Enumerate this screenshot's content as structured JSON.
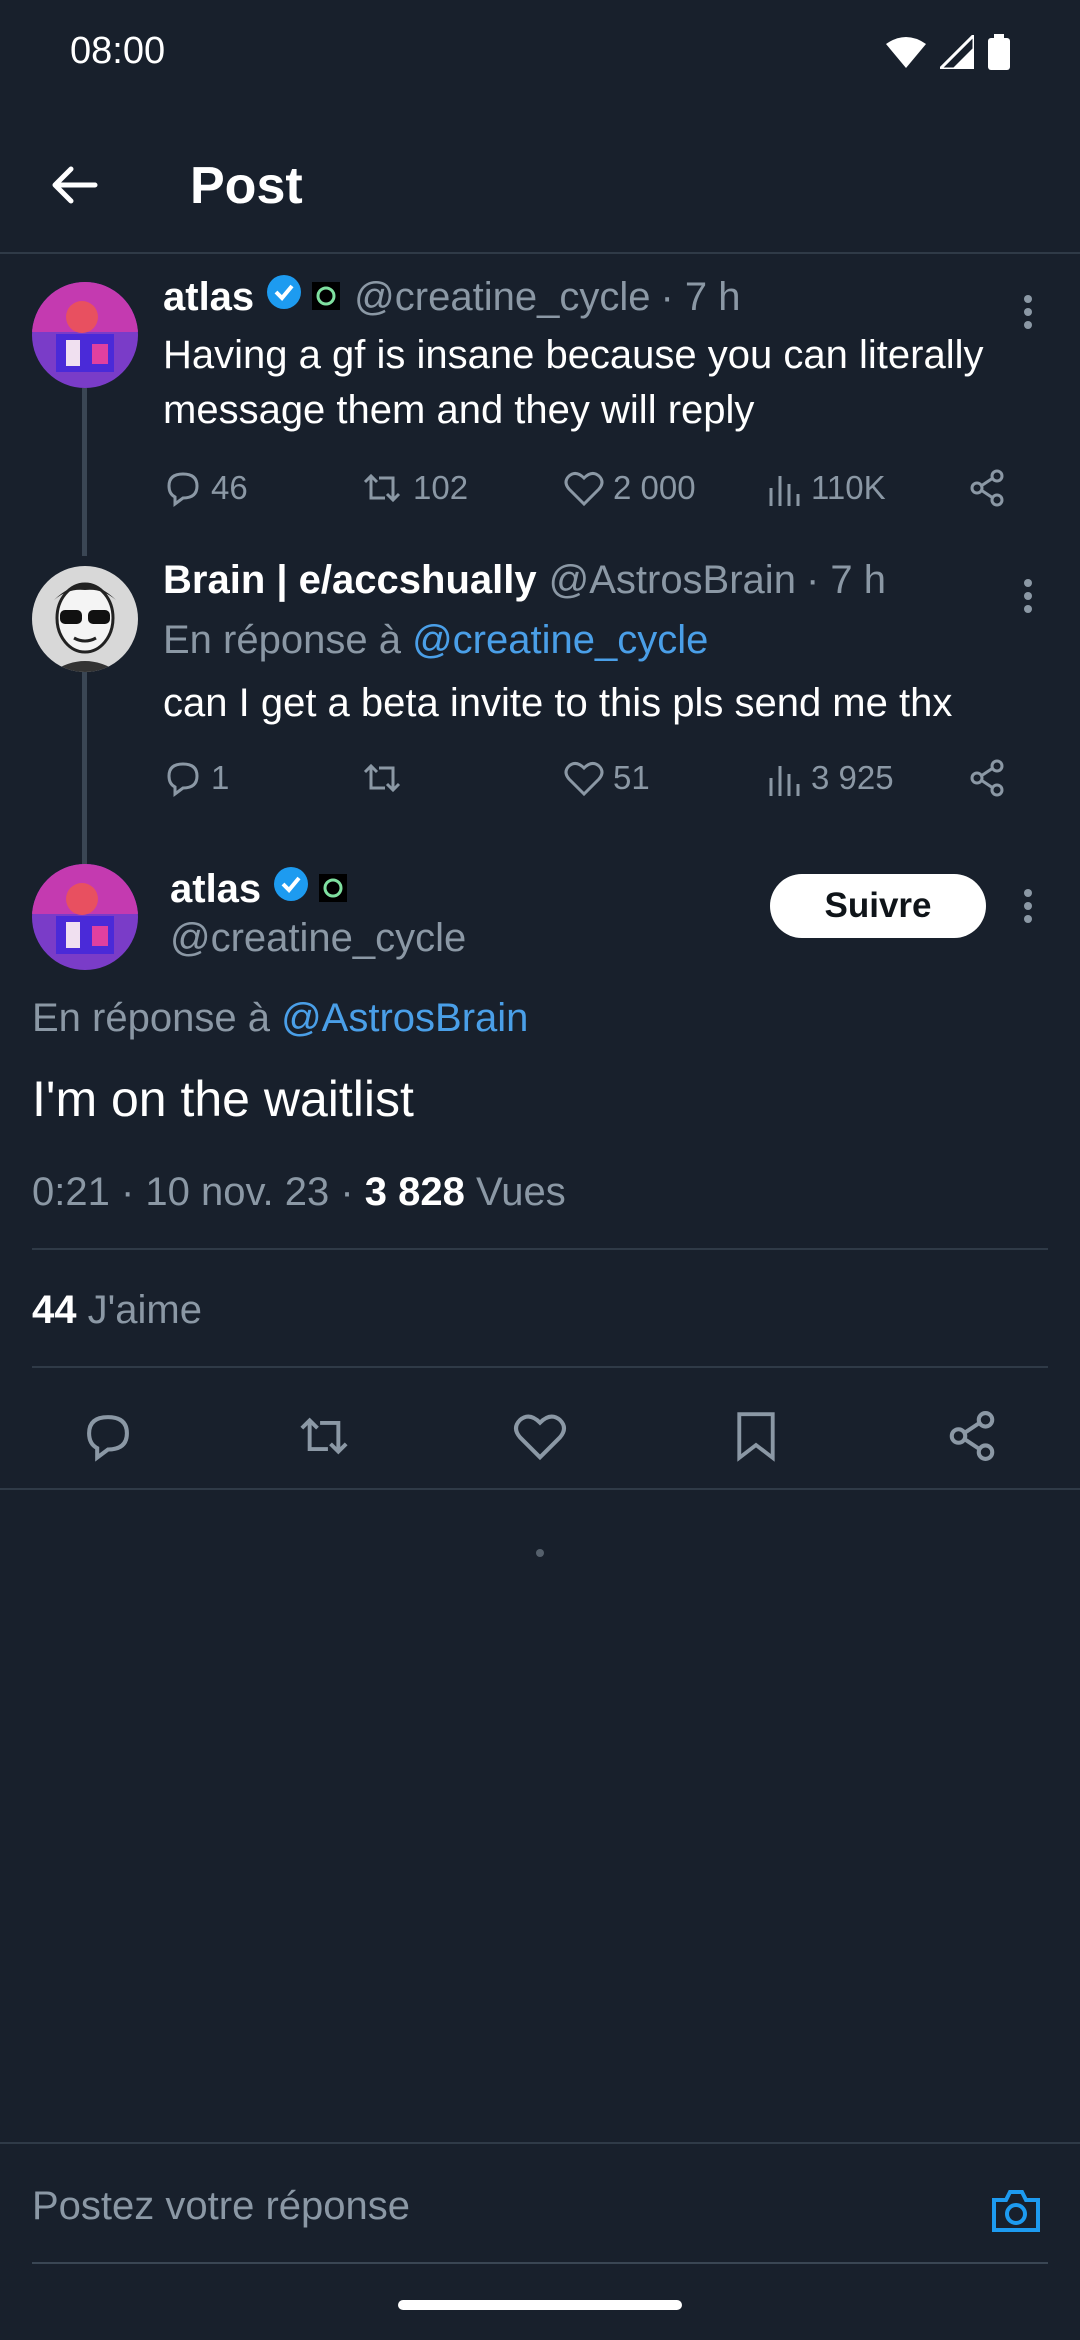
{
  "status": {
    "time": "08:00"
  },
  "header": {
    "title": "Post"
  },
  "colors": {
    "background": "#18202c",
    "link": "#4a9fe8",
    "verified": "#1d9bf0",
    "muted": "#8b98a5"
  },
  "tweets": [
    {
      "name": "atlas",
      "handle": "@creatine_cycle",
      "time": "· 7 h",
      "text": "Having a gf is insane because you can literally message them and they will reply",
      "stats": {
        "replies": "46",
        "retweets": "102",
        "likes": "2 000",
        "views": "110K"
      }
    },
    {
      "name": "Brain | e/accshually",
      "handle": "@AstrosBrain",
      "time": "· 7 h",
      "reply_prefix": "En réponse à",
      "reply_to": "@creatine_cycle",
      "text": "can I get a beta invite to this pls send me thx",
      "stats": {
        "replies": "1",
        "retweets": "",
        "likes": "51",
        "views": "3 925"
      }
    }
  ],
  "main_tweet": {
    "name": "atlas",
    "handle": "@creatine_cycle",
    "follow_label": "Suivre",
    "reply_prefix": "En réponse à",
    "reply_to": "@AstrosBrain",
    "text": "I'm on the waitlist",
    "meta_time": "0:21 · 10 nov. 23 · ",
    "views_count": "3 828",
    "views_label": " Vues",
    "likes_count": "44",
    "likes_label": " J'aime"
  },
  "reply_bar": {
    "placeholder": "Postez votre réponse"
  }
}
